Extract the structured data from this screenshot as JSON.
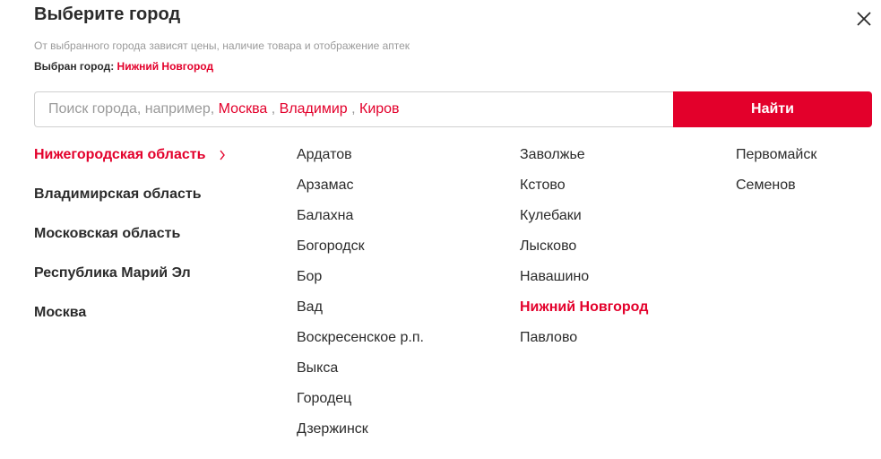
{
  "modal": {
    "title": "Выберите город",
    "subtitle": "От выбранного города зависят цены, наличие товара и отображение аптек",
    "selected_label": "Выбран город:",
    "selected_city": "Нижний Новгород"
  },
  "search": {
    "placeholder_prefix": "Поиск города, например,",
    "examples": [
      "Москва",
      "Владимир",
      "Киров"
    ],
    "button_label": "Найти"
  },
  "regions": [
    {
      "label": "Нижегородская область",
      "active": true
    },
    {
      "label": "Владимирская область",
      "active": false
    },
    {
      "label": "Московская область",
      "active": false
    },
    {
      "label": "Республика Марий Эл",
      "active": false
    },
    {
      "label": "Москва",
      "active": false
    }
  ],
  "cities": {
    "column1": [
      "Ардатов",
      "Арзамас",
      "Балахна",
      "Богородск",
      "Бор",
      "Вад",
      "Воскресенское р.п.",
      "Выкса",
      "Городец",
      "Дзержинск"
    ],
    "column2": [
      "Заволжье",
      "Кстово",
      "Кулебаки",
      "Лысково",
      "Навашино",
      "Нижний Новгород",
      "Павлово"
    ],
    "column3": [
      "Первомайск",
      "Семенов"
    ]
  },
  "colors": {
    "accent": "#e3002b",
    "text": "#2b2b2b",
    "muted": "#9a9a9a"
  },
  "icons": {
    "close": "close-icon",
    "region_chevron": "chevron-right-icon"
  }
}
